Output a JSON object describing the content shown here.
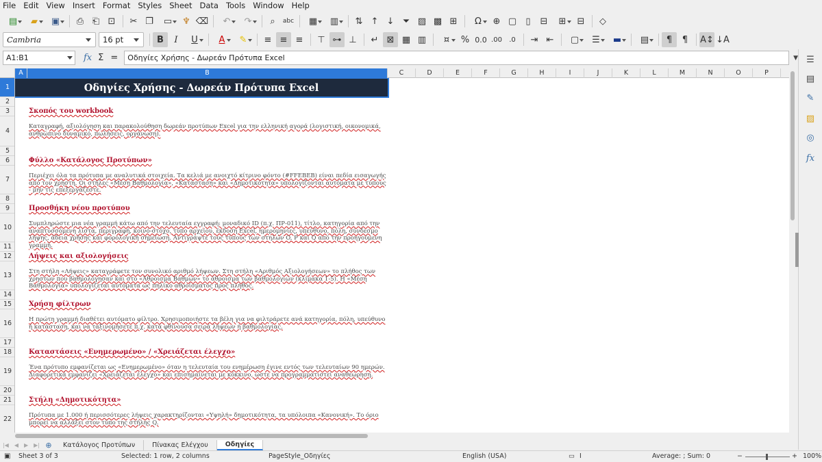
{
  "menu": [
    "File",
    "Edit",
    "View",
    "Insert",
    "Format",
    "Styles",
    "Sheet",
    "Data",
    "Tools",
    "Window",
    "Help"
  ],
  "format_bar": {
    "font_name": "Cambria",
    "font_size": "16 pt"
  },
  "formula_bar": {
    "cell_ref": "A1:B1",
    "content": "Οδηγίες Χρήσης - Δωρεάν Πρότυπα Excel"
  },
  "columns": [
    "A",
    "B",
    "C",
    "D",
    "E",
    "F",
    "G",
    "H",
    "I",
    "J",
    "K",
    "L",
    "M",
    "N",
    "O",
    "P"
  ],
  "rows": [
    "1",
    "2",
    "3",
    "4",
    "5",
    "6",
    "7",
    "8",
    "9",
    "10",
    "11",
    "12",
    "13",
    "14",
    "15",
    "16",
    "17",
    "18",
    "19",
    "20",
    "21",
    "22",
    "23"
  ],
  "sheet": {
    "title": "Οδηγίες Χρήσης - Δωρεάν Πρότυπα Excel",
    "sections": [
      {
        "heading": "Σκοπός του workbook",
        "body": "Καταγραφή, αξιολόγηση και παρακολούθηση δωρεάν προτύπων Excel για την ελληνική αγορά (λογιστική, οικονομικά, ανθρώπινο δυναμικό, πωλήσεις, οργάνωση)."
      },
      {
        "heading": "Φύλλο «Κατάλογος Προτύπων»",
        "body": "Περιέχει όλα τα πρότυπα με αναλυτικά στοιχεία. Τα κελιά με ανοιχτό κίτρινο φόντο (#FFEBEB) είναι πεδία εισαγωγής από τον χρήστη. Οι στήλες «Μέση Βαθμολογία», «Κατάσταση» και «Δημοτικότητα» υπολογίζονται αυτόματα με τύπους - μην τις επεξεργάζεστε."
      },
      {
        "heading": "Προσθήκη νέου προτύπου",
        "body": "Συμπληρώστε μια νέα γραμμή κάτω από την τελευταία εγγραφή: μοναδικό ID (π.χ. ΠΡ-011), τίτλο, κατηγορία από την αναπτυσσόμενη λίστα, περιγραφή, κοινό-στόχο, τύπο αρχείου, έκδοση Excel, ημερομηνίες, υπεύθυνο, πόλη, σύνδεσμο λήψης, άδεια χρήσης και φορολογική σημείωση. Αντιγράψτε τους τύπους των στηλών O, P και Q από την προηγούμενη γραμμή."
      },
      {
        "heading": "Λήψεις και αξιολογήσεις",
        "body": "Στη στήλη «Λήψεις» καταγράφετε τον συνολικό αριθμό λήψεων. Στη στήλη «Αριθμός Αξιολογήσεων» το πλήθος των χρηστών που βαθμολόγησαν και στο «Άθροισμα Βαθμών» το άθροισμα των βαθμολογιών (κλίμακα 1-5). Η «Μέση Βαθμολογία» υπολογίζεται αυτόματα ως πηλίκο αθροίσματος προς πλήθος."
      },
      {
        "heading": "Χρήση φίλτρων",
        "body": "Η πρώτη γραμμή διαθέτει αυτόματο φίλτρο. Χρησιμοποιήστε τα βέλη για να φιλτράρετε ανά κατηγορία, πόλη, υπεύθυνο ή κατάσταση, και να ταξινομήσετε π.χ. κατά φθίνουσα σειρά λήψεων ή βαθμολογίας."
      },
      {
        "heading": "Καταστάσεις «Ενημερωμένο» / «Χρειάζεται έλεγχο»",
        "body": "Ένα πρότυπο εμφανίζεται ως «Ενημερωμένο» όταν η τελευταία του ενημέρωση έγινε εντός των τελευταίων 90 ημερών. Διαφορετικά εμφανίζει «Χρειάζεται έλεγχο» και επισημαίνεται με κόκκινο, ώστε να προγραμματιστεί αναθεώρηση."
      },
      {
        "heading": "Στήλη «Δημοτικότητα»",
        "body": "Πρότυπα με 1.000 ή περισσότερες λήψεις χαρακτηρίζονται «Υψηλή» δημοτικότητα, τα υπόλοιπα «Κανονική». Το όριο μπορεί να αλλάξει στον τύπο της στήλης Q."
      }
    ]
  },
  "tabs": [
    "Κατάλογος Προτύπων",
    "Πίνακας Ελέγχου",
    "Οδηγίες"
  ],
  "active_tab": "Οδηγίες",
  "status": {
    "sheet": "Sheet 3 of 3",
    "selection": "Selected: 1 row, 2 columns",
    "page_style": "PageStyle_Οδηγίες",
    "language": "English (USA)",
    "summary": "Average: ; Sum: 0",
    "zoom": "100%"
  },
  "colors": {
    "title_bg": "#1e2a3d",
    "heading": "#b0102b",
    "selection": "#2e7ad9"
  }
}
